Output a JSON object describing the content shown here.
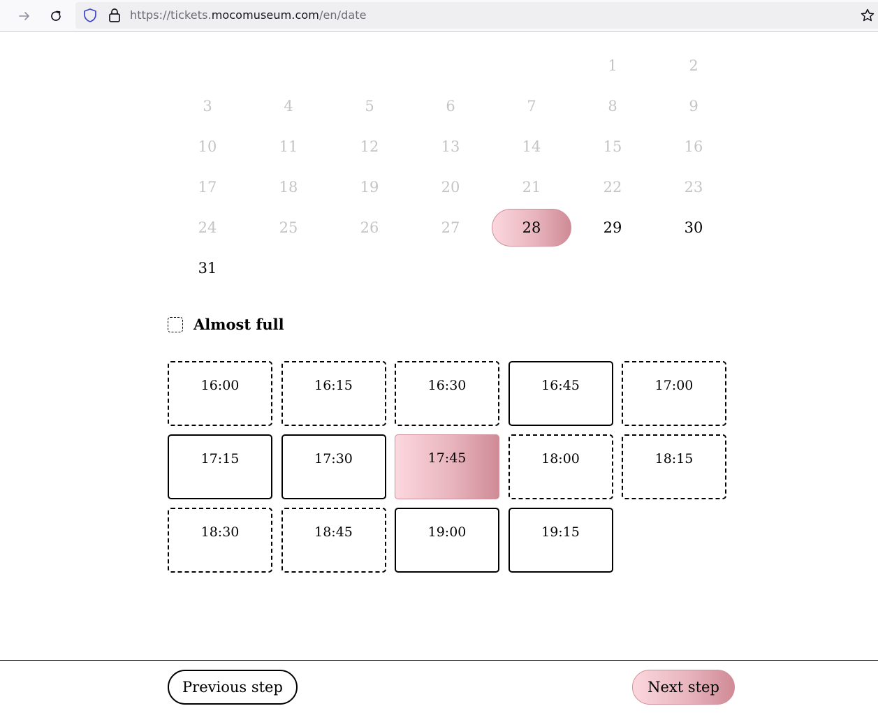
{
  "browser": {
    "url_prefix": "https://tickets.",
    "url_domain": "mocomuseum.com",
    "url_path": "/en/date",
    "icons": [
      "forward-icon",
      "reload-icon",
      "shield-icon",
      "lock-icon",
      "bookmark-star-icon"
    ]
  },
  "calendar": {
    "weeks": [
      [
        null,
        null,
        null,
        null,
        null,
        {
          "day": "1",
          "state": "disabled"
        },
        {
          "day": "2",
          "state": "disabled"
        }
      ],
      [
        {
          "day": "3",
          "state": "disabled"
        },
        {
          "day": "4",
          "state": "disabled"
        },
        {
          "day": "5",
          "state": "disabled"
        },
        {
          "day": "6",
          "state": "disabled"
        },
        {
          "day": "7",
          "state": "disabled"
        },
        {
          "day": "8",
          "state": "disabled"
        },
        {
          "day": "9",
          "state": "disabled"
        }
      ],
      [
        {
          "day": "10",
          "state": "disabled"
        },
        {
          "day": "11",
          "state": "disabled"
        },
        {
          "day": "12",
          "state": "disabled"
        },
        {
          "day": "13",
          "state": "disabled"
        },
        {
          "day": "14",
          "state": "disabled"
        },
        {
          "day": "15",
          "state": "disabled"
        },
        {
          "day": "16",
          "state": "disabled"
        }
      ],
      [
        {
          "day": "17",
          "state": "disabled"
        },
        {
          "day": "18",
          "state": "disabled"
        },
        {
          "day": "19",
          "state": "disabled"
        },
        {
          "day": "20",
          "state": "disabled"
        },
        {
          "day": "21",
          "state": "disabled"
        },
        {
          "day": "22",
          "state": "disabled"
        },
        {
          "day": "23",
          "state": "disabled"
        }
      ],
      [
        {
          "day": "24",
          "state": "disabled"
        },
        {
          "day": "25",
          "state": "disabled"
        },
        {
          "day": "26",
          "state": "disabled"
        },
        {
          "day": "27",
          "state": "disabled"
        },
        {
          "day": "28",
          "state": "selected"
        },
        {
          "day": "29",
          "state": "available"
        },
        {
          "day": "30",
          "state": "available"
        }
      ],
      [
        {
          "day": "31",
          "state": "available"
        },
        null,
        null,
        null,
        null,
        null,
        null
      ]
    ]
  },
  "legend": {
    "label": "Almost full"
  },
  "slots": [
    {
      "time": "16:00",
      "state": "almost-full"
    },
    {
      "time": "16:15",
      "state": "almost-full"
    },
    {
      "time": "16:30",
      "state": "almost-full"
    },
    {
      "time": "16:45",
      "state": "available"
    },
    {
      "time": "17:00",
      "state": "almost-full"
    },
    {
      "time": "17:15",
      "state": "available"
    },
    {
      "time": "17:30",
      "state": "available"
    },
    {
      "time": "17:45",
      "state": "selected"
    },
    {
      "time": "18:00",
      "state": "almost-full"
    },
    {
      "time": "18:15",
      "state": "almost-full"
    },
    {
      "time": "18:30",
      "state": "almost-full"
    },
    {
      "time": "18:45",
      "state": "almost-full"
    },
    {
      "time": "19:00",
      "state": "available"
    },
    {
      "time": "19:15",
      "state": "available"
    }
  ],
  "footer": {
    "previous_label": "Previous step",
    "next_label": "Next step"
  },
  "colors": {
    "accent_light": "#fcd7de",
    "accent_mid": "#e8b4bd",
    "accent_dark": "#cf8b96",
    "disabled_text": "#c4c4c4"
  }
}
